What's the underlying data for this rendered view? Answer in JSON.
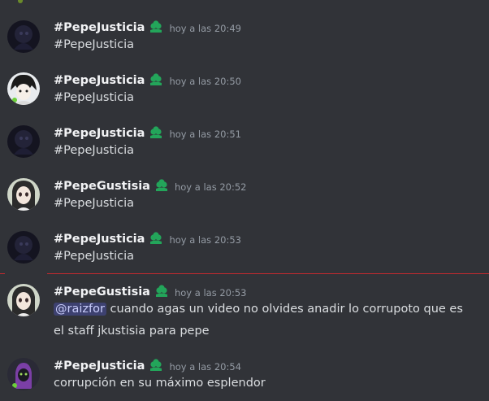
{
  "messages": [
    {
      "username": "#PepeJusticia",
      "timestamp": "hoy a las 20:49",
      "text": "#PepeJusticia",
      "avatar": "dark-avatar"
    },
    {
      "username": "#PepeJusticia",
      "timestamp": "hoy a las 20:50",
      "text": "#PepeJusticia",
      "avatar": "anime-avatar"
    },
    {
      "username": "#PepeJusticia",
      "timestamp": "hoy a las 20:51",
      "text": "#PepeJusticia",
      "avatar": "dark-avatar"
    },
    {
      "username": "#PepeGustisia",
      "timestamp": "hoy a las 20:52",
      "text": "#PepeJusticia",
      "avatar": "girl-avatar"
    },
    {
      "username": "#PepeJusticia",
      "timestamp": "hoy a las 20:53",
      "text": "#PepeJusticia",
      "avatar": "dark-avatar"
    },
    {
      "username": "#PepeGustisia",
      "timestamp": "hoy a las 20:53",
      "mention": "@raizfor",
      "text": " cuando agas un video no olvides anadir lo corrupoto que es el staff jkustisia para pepe",
      "avatar": "girl-avatar"
    },
    {
      "username": "#PepeJusticia",
      "timestamp": "hoy a las 20:54",
      "text": "corrupción en su máximo esplendor",
      "avatar": "purple-avatar"
    }
  ],
  "badge_icon": "clover-badge-icon",
  "colors": {
    "background": "#313338",
    "username": "#f2f3f5",
    "timestamp": "#949ba4",
    "text": "#dbdee1",
    "badge": "#23a55a",
    "new_messages_divider": "#c42a2f",
    "mention_bg": "#3c4270"
  }
}
